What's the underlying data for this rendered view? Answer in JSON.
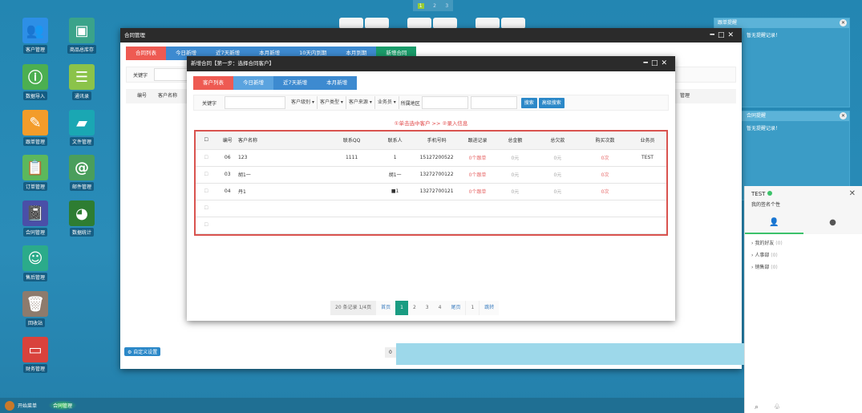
{
  "desktop": {
    "icons": [
      {
        "label": "客户管理",
        "icon": "users-icon",
        "color": "#2d8fe6",
        "glyph": "👥"
      },
      {
        "label": "商品总库存",
        "icon": "box-icon",
        "color": "#3aa38a",
        "glyph": "▣"
      },
      {
        "label": "数据导入",
        "icon": "info-icon",
        "color": "#4caf50",
        "glyph": "ⓘ"
      },
      {
        "label": "通讯录",
        "icon": "list-icon",
        "color": "#8bc34a",
        "glyph": "☰"
      },
      {
        "label": "跟单管理",
        "icon": "edit-icon",
        "color": "#f39c2a",
        "glyph": "✎"
      },
      {
        "label": "文件管理",
        "icon": "folder-icon",
        "color": "#1aa7b3",
        "glyph": "▰"
      },
      {
        "label": "订单管理",
        "icon": "clipboard-icon",
        "color": "#5cb85c",
        "glyph": "📋"
      },
      {
        "label": "邮件管理",
        "icon": "at-icon",
        "color": "#4a9e5c",
        "glyph": "@"
      },
      {
        "label": "合同管理",
        "icon": "notebook-icon",
        "color": "#4a4fa8",
        "glyph": "📓"
      },
      {
        "label": "数据统计",
        "icon": "pie-chart-icon",
        "color": "#2e7d32",
        "glyph": "◕"
      },
      {
        "label": "售后管理",
        "icon": "agent-icon",
        "color": "#2bab8a",
        "glyph": "☺"
      },
      {
        "label": "回收站",
        "icon": "trash-icon",
        "color": "#8d7b6d",
        "glyph": "🗑"
      },
      {
        "label": "财务管理",
        "icon": "wallet-icon",
        "color": "#d9423c",
        "glyph": "▭"
      }
    ]
  },
  "pager_top": [
    "1",
    "2",
    "3"
  ],
  "contract_window": {
    "title": "合同管理",
    "tabs": [
      "合同列表",
      "今日新增",
      "近7天新增",
      "本月新增",
      "10天内到期",
      "本月到期",
      "新增合同"
    ],
    "search_label": "关键字",
    "columns": [
      "编号",
      "客户名称",
      "管理"
    ],
    "footer_button": "自定义设置",
    "footer_text": "0"
  },
  "modal": {
    "title": "新增合同【第一步：选择合同客户】",
    "tabs": [
      "客户列表",
      "今日新增",
      "近7天新增",
      "本月新增"
    ],
    "filter": {
      "keyword_label": "关键字",
      "selects": [
        "客户级别",
        "客户类型",
        "客户来源",
        "业务员"
      ],
      "region_label": "所属地区",
      "search_button": "搜索",
      "advanced_button": "高级搜索"
    },
    "hint": "①单击选中客户 >> ②录入信息",
    "columns": [
      "编号",
      "客户名称",
      "联系QQ",
      "联系人",
      "手机号码",
      "跟进记录",
      "总金额",
      "总欠款",
      "购买次数",
      "业务员"
    ],
    "rows": [
      {
        "id": "06",
        "name": "123",
        "qq": "1111",
        "contact": "1",
        "phone": "15127200522",
        "follow": "0个跟单",
        "amount": "0元",
        "debt": "0元",
        "times": "0次",
        "sales": "TEST"
      },
      {
        "id": "03",
        "name": "胡1一",
        "qq": "",
        "contact": "胡1一",
        "phone": "13272700122",
        "follow": "0个跟单",
        "amount": "0元",
        "debt": "0元",
        "times": "0次",
        "sales": ""
      },
      {
        "id": "04",
        "name": "丹1",
        "qq": "",
        "contact": "■1",
        "phone": "13272700121",
        "follow": "0个跟单",
        "amount": "0元",
        "debt": "0元",
        "times": "0次",
        "sales": ""
      },
      {
        "id": "",
        "name": "",
        "qq": "",
        "contact": "",
        "phone": "",
        "follow": "",
        "amount": "",
        "debt": "",
        "times": "",
        "sales": ""
      },
      {
        "id": "",
        "name": "",
        "qq": "",
        "contact": "",
        "phone": "",
        "follow": "",
        "amount": "",
        "debt": "",
        "times": "",
        "sales": ""
      }
    ],
    "pagination": {
      "summary": "20 条记录 1/4页",
      "first": "首页",
      "pages": [
        "1",
        "2",
        "3",
        "4"
      ],
      "current": "1",
      "last": "尾页",
      "goto": "1",
      "go": "跳转"
    }
  },
  "notes": [
    {
      "title": "跟单提醒",
      "body": "暂无提醒记录！"
    },
    {
      "title": "合同提醒",
      "body": "暂无提醒记录！"
    }
  ],
  "chat": {
    "user": "TEST",
    "status": "我的签名个性",
    "groups": [
      {
        "name": "我的好友",
        "count": "(0)"
      },
      {
        "name": "人事部",
        "count": "(0)"
      },
      {
        "name": "销售部",
        "count": "(0)"
      }
    ]
  },
  "taskbar": {
    "start": "开始菜单",
    "task": "合同管理"
  }
}
